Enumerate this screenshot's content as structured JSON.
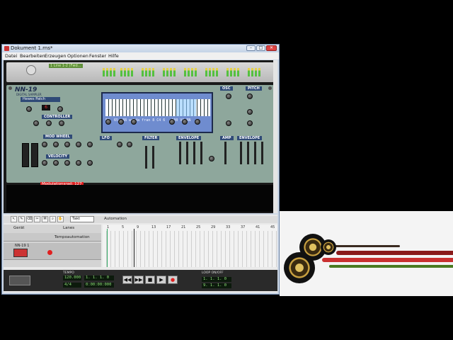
{
  "window": {
    "title": "Dokument 1.rns*",
    "controls": {
      "minimize": "–",
      "maximize": "□",
      "close": "✕"
    }
  },
  "menu": [
    "Datei",
    "Bearbeiten",
    "Erzeugen",
    "Optionen",
    "Fenster",
    "Hilfe"
  ],
  "hardware": {
    "line_display": "1 Line 1-2 (Fwd…"
  },
  "nn19": {
    "name": "NN-19",
    "subtitle": "DIGITAL SAMPLER",
    "patch_name": "Hewes Patch",
    "sections": {
      "controller": "CONTROLLER",
      "mod_wheel": "MOD WHEEL",
      "velocity": "VELOCITY",
      "lfo": "LFO",
      "filter": "FILTER",
      "envelope": "ENVELOPE",
      "amp": "AMP",
      "amp_envelope": "ENVELOPE",
      "osc": "OSC",
      "pitch": "PITCH"
    },
    "display": {
      "row1": "F3  65  88 wahda fran 8 C4 6   100 VA-RN"
    },
    "tooltip": "Modulationsrad: 127"
  },
  "sequencer": {
    "toolbar_snap": "Takt",
    "automation_label": "Automation",
    "columns": {
      "device": "Gerät",
      "lane": "Lanes"
    },
    "tracks": [
      {
        "name": "Tempoautomation"
      },
      {
        "name": "NN-19 1"
      }
    ],
    "ruler": [
      "1",
      "5",
      "9",
      "13",
      "17",
      "21",
      "25",
      "29",
      "33",
      "37",
      "41",
      "45"
    ]
  },
  "transport": {
    "tempo": "120.000",
    "signature": "4/4",
    "position": "1. 1. 1.  0",
    "time": "0:00:00:000",
    "loop_left": "1. 1. 1.  0",
    "loop_right": "9. 1. 1.  0",
    "labels": {
      "tempo": "TEMPO",
      "loop": "LOOP ON/OFF"
    }
  },
  "colors": {
    "rack_bg": "#1a1a1a",
    "nn19_panel": "#8ea79c",
    "display_bg": "#6f8ccf",
    "record": "#e02020"
  }
}
